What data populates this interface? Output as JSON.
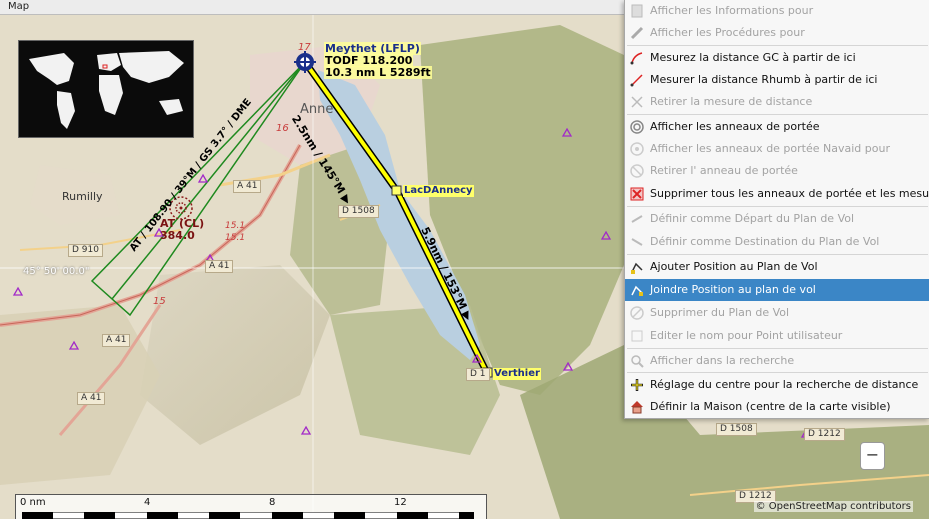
{
  "window": {
    "title": "Map"
  },
  "map": {
    "labels": {
      "annecy": "Anne",
      "rumilly": "Rumilly",
      "route_a41_1": "A 41",
      "route_a41_2": "A 41",
      "route_a41_3": "A 41",
      "route_a41_4": "A 41",
      "route_d1508_1": "D 1508",
      "route_d1508_2": "D 1508",
      "route_d910": "D 910",
      "route_d1212_1": "D 1212",
      "route_d1212_2": "D 1212",
      "route_d1": "D 1",
      "num_16": "16",
      "num_15": "15",
      "num_151": "15.1",
      "num_151b": "15.1",
      "num_17": "17"
    },
    "coordinate_label": "45° 50' 00.0\"",
    "airport": {
      "name": "Meythet (LFLP)",
      "freq": "TODF 118.200",
      "runway": "10.3 nm L 5289ft"
    },
    "approach": {
      "text": "AT / 108.90 / 39°M / GS 3.7° / DME",
      "at_name": "AT (CL)",
      "at_freq": "384.0"
    },
    "route": {
      "leg1": "2.5nm / 145°M ▶",
      "leg2": "5.9nm / 153°M ▶",
      "waypoints": [
        "LacDAnnecy",
        "Verthier"
      ]
    },
    "scale": {
      "ticks": [
        "0 nm",
        "4",
        "8",
        "12"
      ]
    },
    "attribution": "© OpenStreetMap contributors",
    "zoom_out": "−"
  },
  "context_menu": {
    "items": [
      {
        "label": "Afficher les Informations pour",
        "icon": "info-icon",
        "enabled": false
      },
      {
        "label": "Afficher les Procédures pour",
        "icon": "procedure-icon",
        "enabled": false
      },
      {
        "label": "Mesurez la distance GC à partir de ici",
        "icon": "measure-gc-icon",
        "enabled": true
      },
      {
        "label": "Mesurer la distance Rhumb à partir de ici",
        "icon": "measure-rhumb-icon",
        "enabled": true
      },
      {
        "label": "Retirer la mesure de distance",
        "icon": "remove-measure-icon",
        "enabled": false
      },
      {
        "label": "Afficher les anneaux de portée",
        "icon": "range-rings-icon",
        "enabled": true
      },
      {
        "label": "Afficher les anneaux de portée Navaid pour",
        "icon": "navaid-rings-icon",
        "enabled": false
      },
      {
        "label": "Retirer l' anneau de portée",
        "icon": "remove-ring-icon",
        "enabled": false
      },
      {
        "label": "Supprimer tous les anneaux de portée et les mesures de distance",
        "icon": "delete-all-icon",
        "enabled": true
      },
      {
        "label": "Définir  comme Départ du Plan de Vol",
        "icon": "departure-icon",
        "enabled": false
      },
      {
        "label": "Définir  comme Destination du Plan de Vol",
        "icon": "destination-icon",
        "enabled": false
      },
      {
        "label": "Ajouter Position au Plan de Vol",
        "icon": "add-position-icon",
        "enabled": true
      },
      {
        "label": "Joindre Position au plan de vol",
        "icon": "append-position-icon",
        "enabled": true,
        "selected": true
      },
      {
        "label": "Supprimer du Plan de Vol",
        "icon": "remove-flightplan-icon",
        "enabled": false
      },
      {
        "label": "Editer le nom pour Point utilisateur",
        "icon": "edit-userpoint-icon",
        "enabled": false
      },
      {
        "label": "Afficher  dans la recherche",
        "icon": "search-icon",
        "enabled": false
      },
      {
        "label": "Réglage du centre pour la recherche de distance",
        "icon": "center-icon",
        "enabled": true
      },
      {
        "label": "Définir la Maison (centre de la carte visible)",
        "icon": "home-icon",
        "enabled": true
      }
    ]
  },
  "colors": {
    "menu_selection": "#3b86c6",
    "route_yellow": "#ffff00",
    "approach_green": "#1f8a1f"
  }
}
